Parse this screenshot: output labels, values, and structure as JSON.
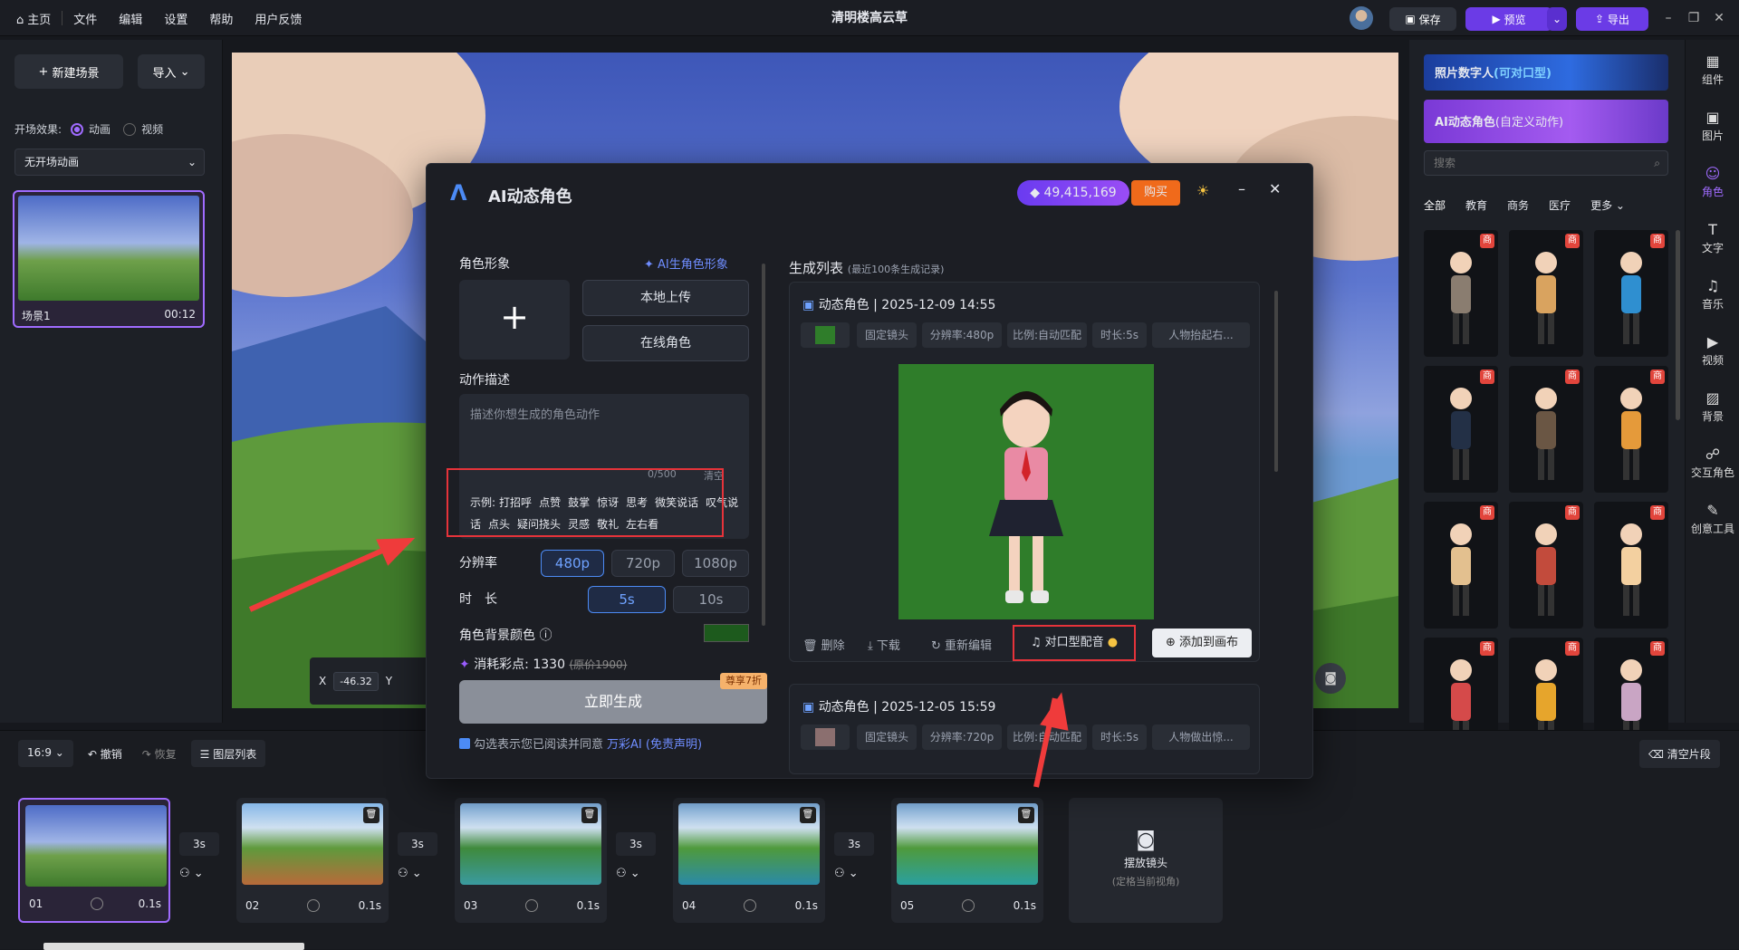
{
  "topbar": {
    "home": "主页",
    "menus": [
      "文件",
      "编辑",
      "设置",
      "帮助",
      "用户反馈"
    ],
    "title": "清明楼高云草",
    "save": "保存",
    "preview": "预览",
    "export": "导出"
  },
  "left": {
    "new_scene": "新建场景",
    "import": "导入",
    "opening_label": "开场效果:",
    "opt_anim": "动画",
    "opt_video": "视频",
    "opening_select": "无开场动画",
    "scene_name": "场景1",
    "scene_time": "00:12"
  },
  "coords": {
    "x_label": "X",
    "x_value": "-46.32",
    "y_label": "Y"
  },
  "dialog": {
    "title": "AI动态角色",
    "points": "49,415,169",
    "buy": "购买",
    "role_image": "角色形象",
    "ai_gen": "AI生角色形象",
    "local_upload": "本地上传",
    "online_role": "在线角色",
    "action_desc": "动作描述",
    "placeholder": "描述你想生成的角色动作",
    "counter": "0/500",
    "clear": "清空",
    "examples_label": "示例:",
    "examples": [
      "打招呼",
      "点赞",
      "鼓掌",
      "惊讶",
      "思考",
      "微笑说话",
      "叹气说话",
      "点头",
      "疑问挠头",
      "灵感",
      "敬礼",
      "左右看"
    ],
    "resolution_label": "分辨率",
    "resolutions": [
      "480p",
      "720p",
      "1080p"
    ],
    "duration_label": "时　长",
    "durations": [
      "5s",
      "10s"
    ],
    "bg_color_label": "角色背景颜色",
    "bg_color": "#1d5a1d",
    "cost_label": "消耗彩点: 1330",
    "cost_orig": "(原价1900)",
    "discount": "尊享7折",
    "generate": "立即生成",
    "agree_text": "勾选表示您已阅读并同意",
    "agree_link": "万彩AI (免责声明)",
    "list_title": "生成列表",
    "list_sub": "(最近100条生成记录)",
    "record1": {
      "title": "动态角色 | 2025-12-09 14:55",
      "tags": [
        "固定镜头",
        "分辨率:480p",
        "比例:自动匹配",
        "时长:5s",
        "人物抬起右..."
      ]
    },
    "record2": {
      "title": "动态角色 | 2025-12-05 15:59",
      "tags": [
        "固定镜头",
        "分辨率:720p",
        "比例:自动匹配",
        "时长:5s",
        "人物做出惊..."
      ]
    },
    "actions": {
      "delete": "删除",
      "download": "下载",
      "re_edit": "重新编辑",
      "lipsync": "对口型配音",
      "add_canvas": "添加到画布"
    }
  },
  "right": {
    "banner1": "照片数字人",
    "banner1_hl": "(可对口型)",
    "banner2": "AI动态角色",
    "banner2_hl": "(自定义动作)",
    "search_placeholder": "搜索",
    "cats": [
      "全部",
      "教育",
      "商务",
      "医疗",
      "更多"
    ],
    "badge": "商"
  },
  "iconbar": [
    {
      "label": "组件",
      "icon": "▦"
    },
    {
      "label": "图片",
      "icon": "▣"
    },
    {
      "label": "角色",
      "icon": "☺"
    },
    {
      "label": "文字",
      "icon": "T"
    },
    {
      "label": "音乐",
      "icon": "♫"
    },
    {
      "label": "视频",
      "icon": "▶"
    },
    {
      "label": "背景",
      "icon": "▨"
    },
    {
      "label": "交互角色",
      "icon": "☍"
    },
    {
      "label": "创意工具",
      "icon": "✎"
    }
  ],
  "timeline": {
    "ratio": "16:9",
    "undo": "撤销",
    "redo": "恢复",
    "layers": "图层列表",
    "clear": "清空片段",
    "camera": "摆放镜头",
    "camera_sub": "(定格当前视角)",
    "scenes": [
      {
        "num": "01",
        "dur": "0.1s"
      },
      {
        "num": "02",
        "dur": "0.1s"
      },
      {
        "num": "03",
        "dur": "0.1s"
      },
      {
        "num": "04",
        "dur": "0.1s"
      },
      {
        "num": "05",
        "dur": "0.1s"
      }
    ],
    "transitions": [
      "3s",
      "3s",
      "3s",
      "3s"
    ]
  }
}
